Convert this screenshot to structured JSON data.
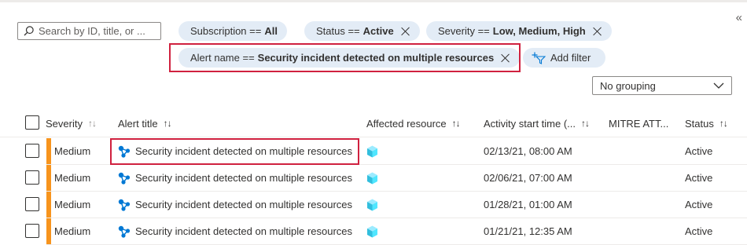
{
  "search": {
    "placeholder": "Search by ID, title, or ..."
  },
  "filters": {
    "subscription": {
      "label": "Subscription ==",
      "value": "All"
    },
    "status": {
      "label": "Status ==",
      "value": "Active"
    },
    "severity": {
      "label": "Severity ==",
      "value": "Low, Medium, High"
    },
    "alert_name": {
      "label": "Alert name ==",
      "value": "Security incident detected on multiple resources"
    },
    "add_filter_label": "Add filter"
  },
  "grouping": {
    "selected": "No grouping"
  },
  "table": {
    "columns": {
      "severity": "Severity",
      "alert_title": "Alert title",
      "affected_resource": "Affected resource",
      "activity_start": "Activity start time (...",
      "mitre": "MITRE ATT...",
      "status": "Status"
    },
    "rows": [
      {
        "severity": "Medium",
        "title": "Security incident detected on multiple resources",
        "activity_start": "02/13/21, 08:00 AM",
        "status": "Active"
      },
      {
        "severity": "Medium",
        "title": "Security incident detected on multiple resources",
        "activity_start": "02/06/21, 07:00 AM",
        "status": "Active"
      },
      {
        "severity": "Medium",
        "title": "Security incident detected on multiple resources",
        "activity_start": "01/28/21, 01:00 AM",
        "status": "Active"
      },
      {
        "severity": "Medium",
        "title": "Security incident detected on multiple resources",
        "activity_start": "01/21/21, 12:35 AM",
        "status": "Active"
      }
    ]
  },
  "icons": {
    "search": "search-icon",
    "remove": "close-icon",
    "add_filter": "add-filter-icon",
    "chevron": "chevron-down-icon",
    "collapse": "double-chevron-left-icon",
    "alert": "incident-icon",
    "resource": "cube-icon"
  },
  "colors": {
    "accent": "#0078d4",
    "severity_medium": "#f7941d",
    "highlight": "#d0213f",
    "pill_bg": "#e3ecf6",
    "resource_icon": "#50e6ff"
  }
}
